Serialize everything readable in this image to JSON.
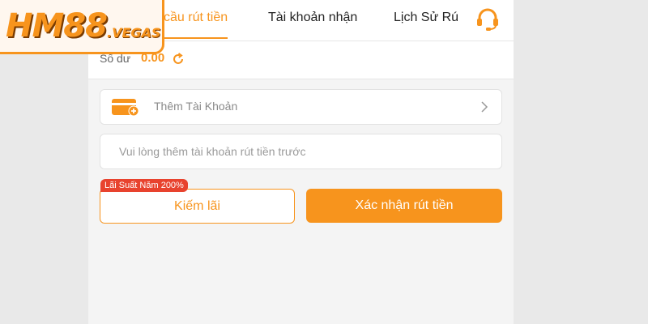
{
  "tabs": [
    {
      "label": "cầu rút tiền",
      "active": true
    },
    {
      "label": "Tài khoản nhận",
      "active": false
    },
    {
      "label": "Lịch Sử Rú",
      "active": false
    }
  ],
  "logo": {
    "main": "HM88",
    "sub": ".VEGAS"
  },
  "balance": {
    "label": "Số dư",
    "value": "0.00"
  },
  "add_account": {
    "label": "Thêm Tài Khoản"
  },
  "hint": {
    "text": "Vui lòng thêm tài khoản rút tiền trước"
  },
  "earn": {
    "label": "Kiếm lãi",
    "badge": "Lãi Suất Năm 200%"
  },
  "confirm": {
    "label": "Xác nhận rút tiền"
  },
  "icons": {
    "support": "headset-icon",
    "refresh": "refresh-icon",
    "wallet": "wallet-add-icon",
    "chevron": "chevron-right-icon"
  },
  "colors": {
    "accent": "#f7941d",
    "badge": "#e8432e",
    "background": "#e9e9e9"
  }
}
